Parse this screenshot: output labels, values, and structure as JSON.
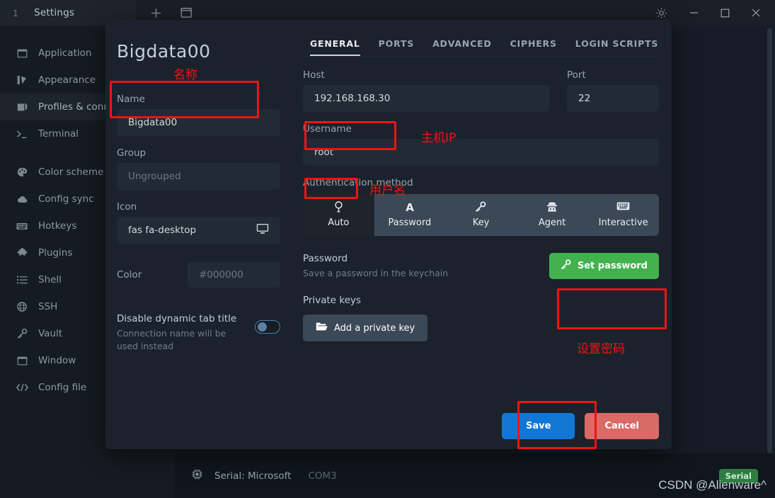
{
  "titlebar": {
    "tab": {
      "index": "1",
      "label": "Settings"
    },
    "new_tab_icon": "plus-icon",
    "split_icon": "window-icon",
    "settings_icon": "gear-icon",
    "minimize_icon": "minimize-icon",
    "maximize_icon": "maximize-icon",
    "close_icon": "close-icon"
  },
  "sidebar": {
    "items": [
      {
        "label": "Application",
        "icon": "window-icon"
      },
      {
        "label": "Appearance",
        "icon": "paint-icon"
      },
      {
        "label": "Profiles & connections",
        "icon": "profiles-icon",
        "active": true
      },
      {
        "label": "Terminal",
        "icon": "terminal-icon"
      },
      {
        "label": "Color scheme",
        "icon": "palette-icon"
      },
      {
        "label": "Config sync",
        "icon": "cloud-icon"
      },
      {
        "label": "Hotkeys",
        "icon": "keyboard-icon"
      },
      {
        "label": "Plugins",
        "icon": "puzzle-icon"
      },
      {
        "label": "Shell",
        "icon": "list-icon"
      },
      {
        "label": "SSH",
        "icon": "globe-icon"
      },
      {
        "label": "Vault",
        "icon": "key-icon"
      },
      {
        "label": "Window",
        "icon": "window-icon"
      },
      {
        "label": "Config file",
        "icon": "code-icon"
      }
    ]
  },
  "dialog": {
    "title": "Bigdata00",
    "title_annotation": "名称",
    "left": {
      "name_label": "Name",
      "name_value": "Bigdata00",
      "group_label": "Group",
      "group_placeholder": "Ungrouped",
      "icon_label": "Icon",
      "icon_value": "fas fa-desktop",
      "icon_preview": "desktop-icon",
      "color_label": "Color",
      "color_placeholder": "#000000",
      "toggle_title": "Disable dynamic tab title",
      "toggle_sub": "Connection name will be used instead",
      "toggle_state": "off"
    },
    "tabs": [
      {
        "label": "GENERAL",
        "active": true
      },
      {
        "label": "PORTS",
        "active": false
      },
      {
        "label": "ADVANCED",
        "active": false
      },
      {
        "label": "CIPHERS",
        "active": false
      },
      {
        "label": "LOGIN SCRIPTS",
        "active": false
      }
    ],
    "general": {
      "host_label": "Host",
      "host_value": "192.168.168.30",
      "host_annotation": "主机IP",
      "port_label": "Port",
      "port_value": "22",
      "username_label": "Username",
      "username_value": "root",
      "username_annotation": "用户名",
      "auth_label": "Authentication method",
      "auth_methods": [
        {
          "label": "Auto",
          "icon": "lightbulb-icon",
          "glyph": "☉",
          "selected": true
        },
        {
          "label": "Password",
          "icon": "font-a-icon",
          "glyph": "A",
          "selected": false
        },
        {
          "label": "Key",
          "icon": "key-icon",
          "glyph": "⚿",
          "selected": false
        },
        {
          "label": "Agent",
          "icon": "user-secret-icon",
          "glyph": "♟",
          "selected": false
        },
        {
          "label": "Interactive",
          "icon": "keyboard-icon",
          "glyph": "⌨",
          "selected": false
        }
      ],
      "password_title": "Password",
      "password_sub": "Save a password in the keychain",
      "set_password_button": "Set password",
      "set_password_icon": "key-icon",
      "set_password_annotation": "设置密码",
      "private_keys_title": "Private keys",
      "add_key_button": "Add a private key",
      "add_key_icon": "folder-open-icon"
    },
    "footer": {
      "save_label": "Save",
      "cancel_label": "Cancel"
    }
  },
  "statusbar": {
    "icon": "chip-icon",
    "text": "Serial: Microsoft",
    "sub": "COM3",
    "badge": "Serial"
  },
  "watermark": "CSDN @Alienware^",
  "colors": {
    "accent_blue": "#1177d4",
    "green": "#42b14e",
    "red": "#d96a66",
    "annotation_red": "#f01414",
    "badge_green": "#2f7d42"
  }
}
